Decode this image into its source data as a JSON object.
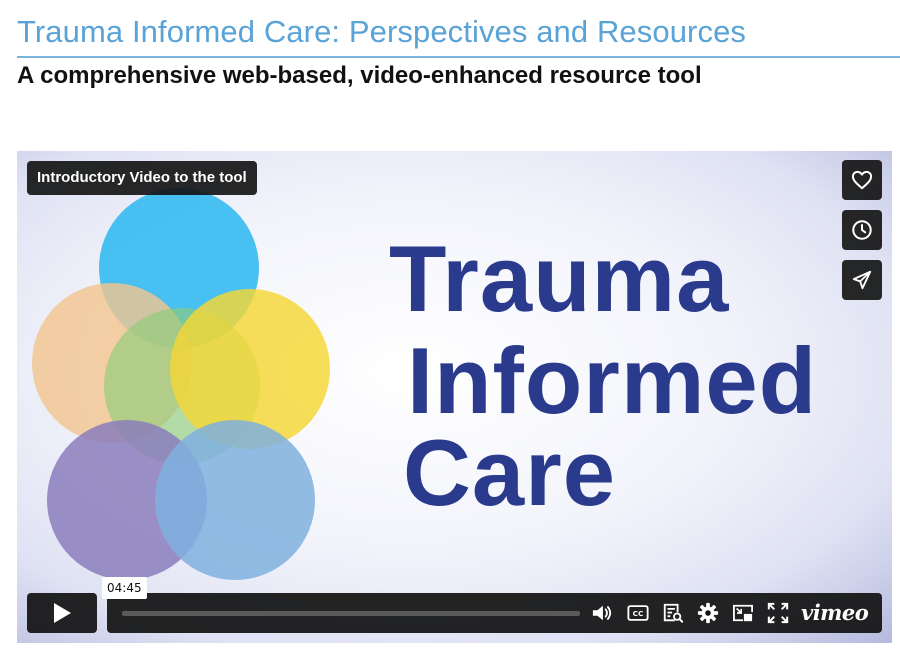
{
  "page": {
    "title": "Trauma Informed Care: Perspectives and Resources",
    "subtitle": "A comprehensive web-based, video-enhanced resource tool"
  },
  "player": {
    "video_title": "Introductory Video to the tool",
    "poster_text": [
      "Trauma",
      "Informed",
      "Care"
    ],
    "time_tooltip": "04:45",
    "progress_fraction": 0.0,
    "logo_text": "vimeo",
    "side_buttons": [
      "heart-icon",
      "clock-icon",
      "paper-plane-icon"
    ],
    "controls": [
      "play-icon",
      "volume-icon",
      "cc-icon",
      "transcript-icon",
      "gear-icon",
      "pip-icon",
      "fullscreen-icon"
    ]
  },
  "colors": {
    "title_blue": "#5aa3d6",
    "poster_text_navy": "#2a3a8c",
    "circle_cyan": "#3ebdf0",
    "circle_peach": "#f2c48e",
    "circle_yellow": "#f5d735",
    "circle_purple": "#8b7cbc",
    "circle_blue": "#7fb0de"
  }
}
